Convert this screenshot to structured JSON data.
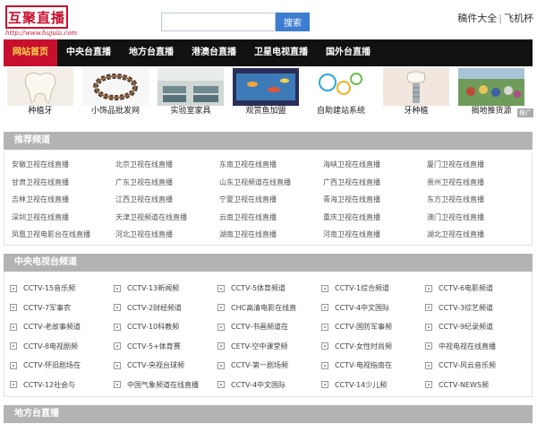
{
  "header": {
    "logo_text": "互聚直播",
    "logo_url": "http://www.hujula.com",
    "search_placeholder": "",
    "search_button": "搜索",
    "links": [
      "稿件大全",
      "飞机杯"
    ]
  },
  "nav": {
    "items": [
      "网站首页",
      "中央台直播",
      "地方台直播",
      "港澳台直播",
      "卫星电视直播",
      "国外台直播"
    ],
    "active_index": 0
  },
  "banner": {
    "items": [
      {
        "caption": "种植牙",
        "icon": "tooth-icon"
      },
      {
        "caption": "小饰品批发网",
        "icon": "bracelet-icon"
      },
      {
        "caption": "实验室家具",
        "icon": "lab-icon"
      },
      {
        "caption": "观赏鱼加盟",
        "icon": "aquarium-icon"
      },
      {
        "caption": "自助建站系统",
        "icon": "website-icon"
      },
      {
        "caption": "牙种植",
        "icon": "implant-icon"
      },
      {
        "caption": "揭地推货源",
        "icon": "crowd-icon"
      }
    ],
    "ad_tag": "推广"
  },
  "recommended": {
    "title": "推荐频道",
    "links": [
      "安徽卫视在线直播",
      "北京卫视在线直播",
      "东南卫视在线直播",
      "海峡卫视在线直播",
      "厦门卫视在线直播",
      "甘肃卫视在线直播",
      "广东卫视在线直播",
      "山东卫视频道在线直播",
      "广西卫视在线直播",
      "贵州卫视在线直播",
      "吉林卫视在线直播",
      "江西卫视在线直播",
      "宁夏卫视在线直播",
      "青海卫视在线直播",
      "东方卫视在线直播",
      "深圳卫视在线直播",
      "天津卫视频道在线直播",
      "云南卫视在线直播",
      "重庆卫视在线直播",
      "澳门卫视在线直播",
      "凤凰卫视电影台在线直播",
      "河北卫视在线直播",
      "湖南卫视在线直播",
      "河南卫视在线直播",
      "湖北卫视在线直播"
    ]
  },
  "cctv": {
    "title": "中央电视台频道",
    "items": [
      "CCTV-15音乐频",
      "CCTV-13新闻频",
      "CCTV-5体育频道",
      "CCTV-1综合频道",
      "CCTV-6电影频道",
      "CCTV-7军事农",
      "CCTV-2财经频道",
      "CHC高清电影在线直",
      "CCTV-4中文国际",
      "CCTV-3综艺频道",
      "CCTV-老故事频道",
      "CCTV-10科教频",
      "CCTV-书画频道在",
      "CCTV-国防军事频",
      "CCTV-9纪录频道",
      "CCTV-8电视剧频",
      "CCTV-5+体育赛",
      "CETV-空中课堂频",
      "CCTV-女性时尚频",
      "中视电视在线直播",
      "CCTV-怀旧剧场在",
      "CCTV-央视台球频",
      "CCTV-第一剧场频",
      "CCTV-电视指南在",
      "CCTV-风云音乐频",
      "CCTV-12社会与",
      "中国气象频道在线直播",
      "CCTV-4中文国际",
      "CCTV-14少儿频",
      "CCTV-NEWS频"
    ]
  },
  "local": {
    "title": "地方台直播"
  }
}
